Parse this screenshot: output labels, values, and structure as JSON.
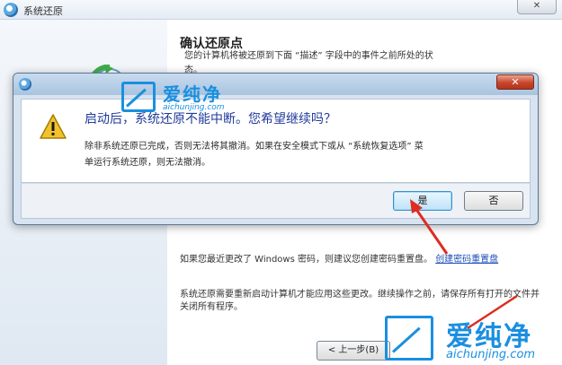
{
  "background_window": {
    "title": "系统还原",
    "close_label": "✕",
    "heading": "确认还原点",
    "subtitle": "您的计算机将被还原到下面 “描述” 字段中的事件之前所处的状",
    "subtitle_cont": "态。",
    "password_note": "如果您最近更改了 Windows 密码，则建议您创建密码重置盘。",
    "password_link": "创建密码重置盘",
    "restart_note": "系统还原需要重新启动计算机才能应用这些更改。继续操作之前，请保存所有打开的文件并关闭所有程序。",
    "back_button": "< 上一步(B)"
  },
  "dialog": {
    "close_label": "✕",
    "headline": "启动后，系统还原不能中断。您希望继续吗？",
    "description_line1": "除非系统还原已完成，否则无法将其撤消。如果在安全模式下或从 “系统恢复选项” 菜",
    "description_line2": "单运行系统还原，则无法撤消。",
    "yes_button": "是",
    "no_button": "否"
  },
  "watermark": {
    "brand_cn": "爱纯净",
    "brand_en": "aichunjing.com",
    "color": "#1a8fe0"
  },
  "annotation": {
    "arrow_color": "#e02b20"
  },
  "icons": {
    "dialog_warning": "warning-icon",
    "title_icon": "system-restore-icon"
  }
}
